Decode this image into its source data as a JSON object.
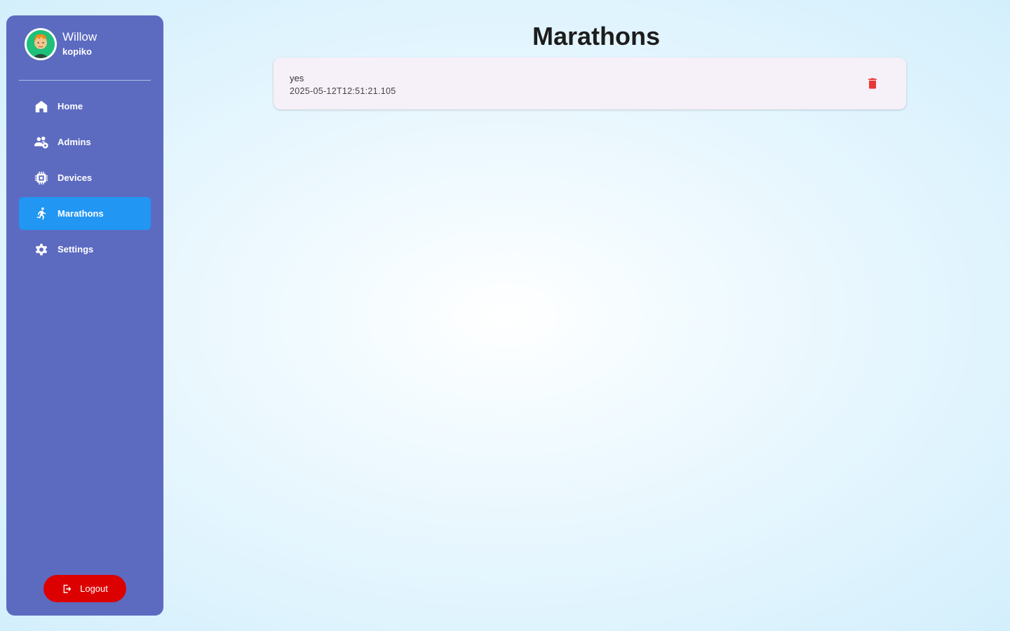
{
  "profile": {
    "name": "Willow",
    "username": "kopiko"
  },
  "nav": {
    "items": [
      {
        "label": "Home",
        "icon": "home-icon"
      },
      {
        "label": "Admins",
        "icon": "admins-icon"
      },
      {
        "label": "Devices",
        "icon": "chip-icon"
      },
      {
        "label": "Marathons",
        "icon": "runner-icon",
        "active": true
      },
      {
        "label": "Settings",
        "icon": "gear-icon"
      }
    ]
  },
  "logout": {
    "label": "Logout"
  },
  "main": {
    "title": "Marathons",
    "marathons": [
      {
        "name": "yes",
        "timestamp": "2025-05-12T12:51:21.105"
      }
    ]
  },
  "colors": {
    "sidebar": "#5c6bc0",
    "active_item": "#2196f3",
    "logout": "#dd0000",
    "delete": "#e53935",
    "card": "#f6f0f8"
  }
}
